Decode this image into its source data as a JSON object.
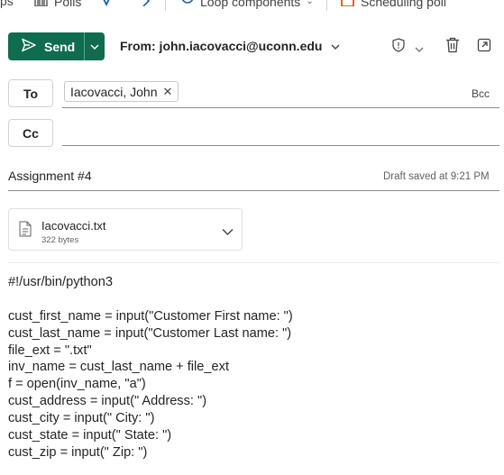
{
  "ribbon": {
    "items": [
      "ps",
      "Polls",
      "Loop components",
      "Scheduling poll"
    ]
  },
  "toolbar": {
    "send_label": "Send",
    "from_label": "From: john.iacovacci@uconn.edu"
  },
  "recipients": {
    "to_label": "To",
    "to_chip": "Iacovacci, John",
    "bcc_label": "Bcc",
    "cc_label": "Cc"
  },
  "subject": {
    "value": "Assignment #4",
    "draft_status": "Draft saved at 9:21 PM"
  },
  "attachment": {
    "name": "Iacovacci.txt",
    "size": "322 bytes"
  },
  "body": {
    "lines": [
      "#!/usr/bin/python3",
      "",
      "cust_first_name = input(\"Customer First name: \")",
      "cust_last_name = input(\"Customer Last name: \")",
      "file_ext = \".txt\"",
      "inv_name = cust_last_name + file_ext",
      "f = open(inv_name, \"a\")",
      "cust_address = input(\" Address: \")",
      "cust_city = input(\" City: \")",
      "cust_state = input(\" State: \")",
      "cust_zip = input(\" Zip: \")"
    ]
  },
  "colors": {
    "send_green": "#0f6c4e",
    "text": "#242424",
    "muted": "#616161",
    "loop_blue": "#1a5fb4",
    "scheduling_orange": "#d83b01"
  }
}
